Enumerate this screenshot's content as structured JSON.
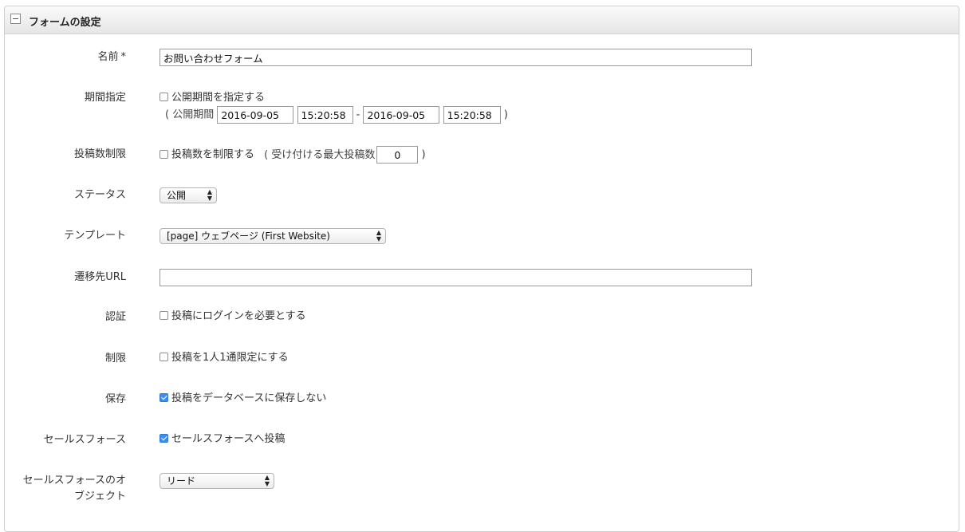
{
  "panel": {
    "title": "フォームの設定"
  },
  "fields": {
    "name": {
      "label": "名前",
      "required_mark": "*",
      "value": "お問い合わせフォーム"
    },
    "period": {
      "label": "期間指定",
      "checkbox_label": "公開期間を指定する",
      "checked": false,
      "prefix": "( 公開期間",
      "start_date": "2016-09-05",
      "start_time": "15:20:58",
      "separator": "-",
      "end_date": "2016-09-05",
      "end_time": "15:20:58",
      "suffix": ")"
    },
    "post_limit": {
      "label": "投稿数制限",
      "checkbox_label": "投稿数を制限する",
      "checked": false,
      "prefix": "( 受け付ける最大投稿数",
      "max_value": "0",
      "suffix": ")"
    },
    "status": {
      "label": "ステータス",
      "selected": "公開"
    },
    "template": {
      "label": "テンプレート",
      "selected": "[page] ウェブページ (First Website)"
    },
    "redirect_url": {
      "label": "遷移先URL",
      "value": ""
    },
    "auth": {
      "label": "認証",
      "checkbox_label": "投稿にログインを必要とする",
      "checked": false
    },
    "restriction": {
      "label": "制限",
      "checkbox_label": "投稿を1人1通限定にする",
      "checked": false
    },
    "save": {
      "label": "保存",
      "checkbox_label": "投稿をデータベースに保存しない",
      "checked": true
    },
    "salesforce": {
      "label": "セールスフォース",
      "checkbox_label": "セールスフォースへ投稿",
      "checked": true
    },
    "salesforce_object": {
      "label_line1": "セールスフォースのオ",
      "label_line2": "ブジェクト",
      "selected": "リード"
    }
  },
  "colors": {
    "checkbox_checked": "#3b8ef0",
    "header_bg": "#ededed"
  }
}
